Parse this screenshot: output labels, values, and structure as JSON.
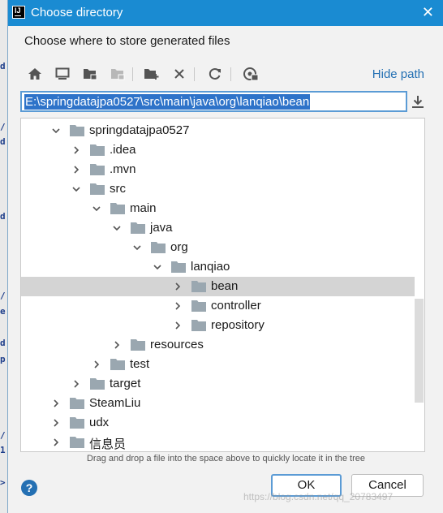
{
  "dialog": {
    "title": "Choose directory",
    "close_glyph": "✕",
    "prompt": "Choose where to store generated files",
    "hide_path_label": "Hide path",
    "path_value": "E:\\springdatajpa0527\\src\\main\\java\\org\\lanqiao\\bean",
    "hint": "Drag and drop a file into the space above to quickly locate it in the tree",
    "ok_label": "OK",
    "cancel_label": "Cancel",
    "help_label": "?"
  },
  "toolbar": {
    "icons": [
      "home-icon",
      "desktop-icon",
      "project-folder-icon",
      "module-folder-icon",
      "new-folder-icon",
      "delete-icon",
      "refresh-icon",
      "show-hidden-icon"
    ]
  },
  "tree": {
    "rows": [
      {
        "label": "springdatajpa0527",
        "expanded": true,
        "has_children": true,
        "selected": false
      },
      {
        "label": ".idea",
        "expanded": false,
        "has_children": true,
        "selected": false
      },
      {
        "label": ".mvn",
        "expanded": false,
        "has_children": true,
        "selected": false
      },
      {
        "label": "src",
        "expanded": true,
        "has_children": true,
        "selected": false
      },
      {
        "label": "main",
        "expanded": true,
        "has_children": true,
        "selected": false
      },
      {
        "label": "java",
        "expanded": true,
        "has_children": true,
        "selected": false
      },
      {
        "label": "org",
        "expanded": true,
        "has_children": true,
        "selected": false
      },
      {
        "label": "lanqiao",
        "expanded": true,
        "has_children": true,
        "selected": false
      },
      {
        "label": "bean",
        "expanded": false,
        "has_children": true,
        "selected": true
      },
      {
        "label": "controller",
        "expanded": false,
        "has_children": true,
        "selected": false
      },
      {
        "label": "repository",
        "expanded": false,
        "has_children": true,
        "selected": false
      },
      {
        "label": "resources",
        "expanded": false,
        "has_children": true,
        "selected": false
      },
      {
        "label": "test",
        "expanded": false,
        "has_children": true,
        "selected": false
      },
      {
        "label": "target",
        "expanded": false,
        "has_children": true,
        "selected": false
      },
      {
        "label": "SteamLiu",
        "expanded": false,
        "has_children": true,
        "selected": false
      },
      {
        "label": "udx",
        "expanded": false,
        "has_children": true,
        "selected": false
      },
      {
        "label": "信息员",
        "expanded": false,
        "has_children": true,
        "selected": false
      }
    ]
  },
  "watermark": "https://blog.csdn.net/qq_20783497",
  "colors": {
    "titlebar": "#1a8bd2",
    "selection": "#2e73c9",
    "link": "#2470b3",
    "folder": "#9aa7b0"
  }
}
